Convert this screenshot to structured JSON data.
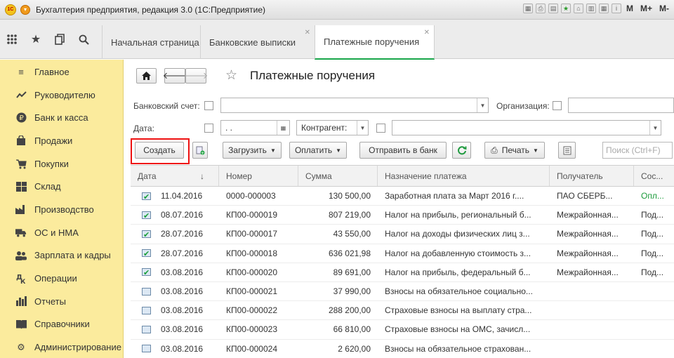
{
  "window": {
    "title": "Бухгалтерия предприятия, редакция 3.0  (1С:Предприятие)",
    "right_labels": [
      "M",
      "M+",
      "M-"
    ]
  },
  "tabs": [
    {
      "label": "Начальная страница",
      "closable": false
    },
    {
      "label": "Банковские выписки",
      "closable": true
    },
    {
      "label": "Платежные поручения",
      "closable": true,
      "active": true
    }
  ],
  "sidebar": {
    "items": [
      {
        "label": "Главное",
        "icon": "menu-lines-icon"
      },
      {
        "label": "Руководителю",
        "icon": "chart-trend-icon"
      },
      {
        "label": "Банк и касса",
        "icon": "ruble-coin-icon"
      },
      {
        "label": "Продажи",
        "icon": "shopping-bag-icon"
      },
      {
        "label": "Покупки",
        "icon": "cart-icon"
      },
      {
        "label": "Склад",
        "icon": "warehouse-grid-icon"
      },
      {
        "label": "Производство",
        "icon": "factory-icon"
      },
      {
        "label": "ОС и НМА",
        "icon": "truck-icon"
      },
      {
        "label": "Зарплата и кадры",
        "icon": "people-icon"
      },
      {
        "label": "Операции",
        "icon": "operations-icon"
      },
      {
        "label": "Отчеты",
        "icon": "bar-chart-icon"
      },
      {
        "label": "Справочники",
        "icon": "book-icon"
      },
      {
        "label": "Администрирование",
        "icon": "gear-icon"
      }
    ]
  },
  "page": {
    "title": "Платежные поручения"
  },
  "filters": {
    "bank_account_label": "Банковский счет:",
    "organization_label": "Организация:",
    "date_label": "Дата:",
    "date_value": " .  .",
    "counterparty_select": "Контрагент:"
  },
  "toolbar": {
    "create": "Создать",
    "load": "Загрузить",
    "pay": "Оплатить",
    "send_bank": "Отправить в банк",
    "print": "Печать",
    "search_placeholder": "Поиск (Ctrl+F)"
  },
  "table": {
    "columns": [
      "Дата",
      "Номер",
      "Сумма",
      "Назначение платежа",
      "Получатель",
      "Сос..."
    ],
    "rows": [
      {
        "date": "11.04.2016",
        "number": "0000-000003",
        "sum": "130 500,00",
        "purpose": "Заработная плата за Март 2016 г....",
        "recipient": "ПАО СБЕРБ...",
        "status": "Опл...",
        "posted": true
      },
      {
        "date": "08.07.2016",
        "number": "КП00-000019",
        "sum": "807 219,00",
        "purpose": "Налог на прибыль, региональный б...",
        "recipient": "Межрайонная...",
        "status": "Под...",
        "posted": true
      },
      {
        "date": "28.07.2016",
        "number": "КП00-000017",
        "sum": "43 550,00",
        "purpose": "Налог на доходы физических лиц з...",
        "recipient": "Межрайонная...",
        "status": "Под...",
        "posted": true
      },
      {
        "date": "28.07.2016",
        "number": "КП00-000018",
        "sum": "636 021,98",
        "purpose": "Налог на добавленную стоимость з...",
        "recipient": "Межрайонная...",
        "status": "Под...",
        "posted": true
      },
      {
        "date": "03.08.2016",
        "number": "КП00-000020",
        "sum": "89 691,00",
        "purpose": "Налог на прибыль, федеральный б...",
        "recipient": "Межрайонная...",
        "status": "Под...",
        "posted": true
      },
      {
        "date": "03.08.2016",
        "number": "КП00-000021",
        "sum": "37 990,00",
        "purpose": "Взносы на обязательное социально...",
        "recipient": "",
        "status": "",
        "posted": false
      },
      {
        "date": "03.08.2016",
        "number": "КП00-000022",
        "sum": "288 200,00",
        "purpose": "Страховые взносы на выплату стра...",
        "recipient": "",
        "status": "",
        "posted": false
      },
      {
        "date": "03.08.2016",
        "number": "КП00-000023",
        "sum": "66 810,00",
        "purpose": "Страховые взносы на ОМС, зачисл...",
        "recipient": "",
        "status": "",
        "posted": false
      },
      {
        "date": "03.08.2016",
        "number": "КП00-000024",
        "sum": "2 620,00",
        "purpose": "Взносы на обязательное страхован...",
        "recipient": "",
        "status": "",
        "posted": false
      }
    ]
  },
  "colors": {
    "sidebar_bg": "#fbeb9d",
    "active_tab_underline": "#19a64a",
    "highlight_box": "#ee1111",
    "paid_status": "#1a9a3a"
  }
}
